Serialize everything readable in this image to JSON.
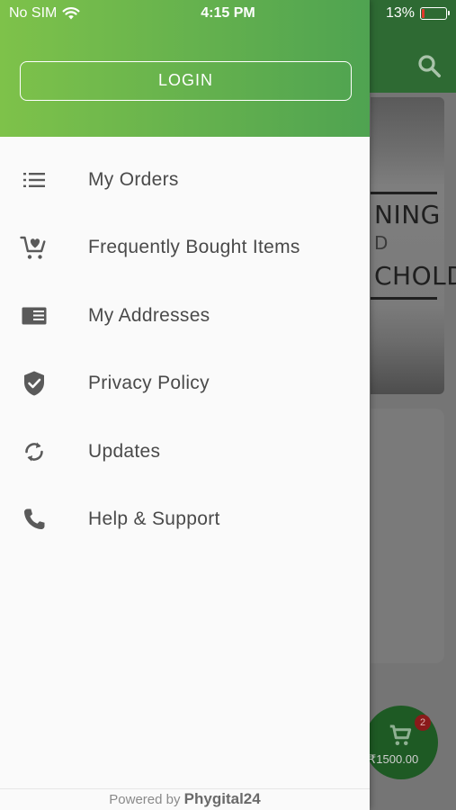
{
  "status_bar": {
    "carrier": "No SIM",
    "time": "4:15 PM",
    "battery_percent": "13%",
    "battery_level": 0.13,
    "battery_color": "#e0392b"
  },
  "drawer": {
    "header_gradient": [
      "#7ec24a",
      "#4fa351"
    ],
    "login_label": "LOGIN",
    "menu": [
      {
        "label": "My Orders",
        "icon": "list-icon"
      },
      {
        "label": "Frequently Bought Items",
        "icon": "cart-heart-icon"
      },
      {
        "label": "My Addresses",
        "icon": "address-card-icon"
      },
      {
        "label": "Privacy Policy",
        "icon": "shield-check-icon"
      },
      {
        "label": "Updates",
        "icon": "sync-icon"
      },
      {
        "label": "Help & Support",
        "icon": "phone-icon"
      }
    ],
    "footer": {
      "prefix": "Powered by",
      "brand": "Phygital24"
    }
  },
  "background": {
    "banner_text": [
      "NING",
      "D",
      "CHOLD"
    ],
    "cart_badge": "2",
    "cart_amount": "₹1500.00"
  }
}
